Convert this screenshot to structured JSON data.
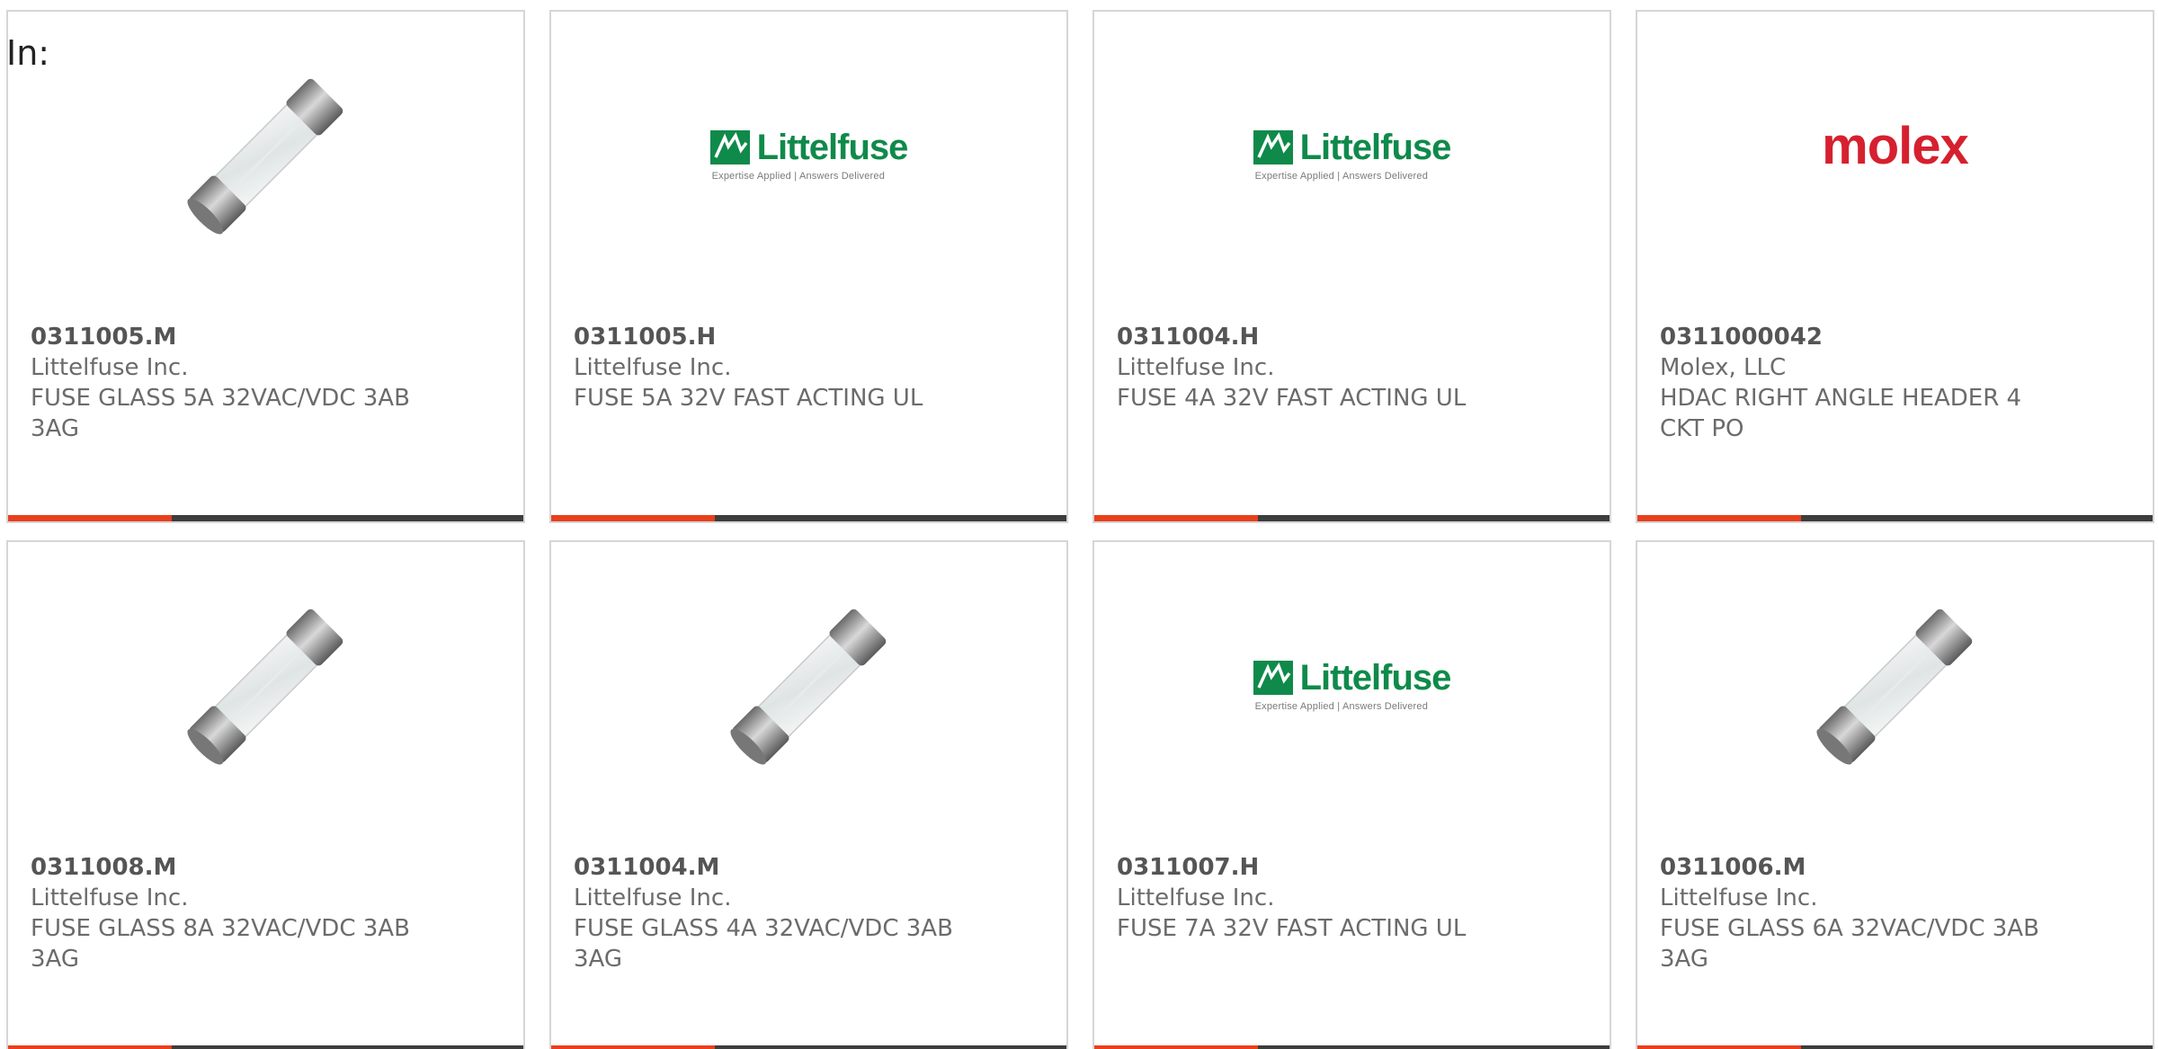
{
  "header": {
    "in_label": "In:"
  },
  "colors": {
    "accent_bar": "#e8401c",
    "bar_dark": "#3d3d3d",
    "littelfuse_green": "#0f8a4a",
    "molex_red": "#d6202f"
  },
  "products": [
    {
      "part": "0311005.M",
      "mfr": "Littelfuse Inc.",
      "desc1": "FUSE GLASS 5A 32VAC/VDC 3AB",
      "desc2": "3AG",
      "image": "glass-fuse-image"
    },
    {
      "part": "0311005.H",
      "mfr": "Littelfuse Inc.",
      "desc1": "FUSE 5A 32V FAST ACTING UL",
      "desc2": "",
      "image": "littelfuse-logo",
      "logo_word": "Littelfuse",
      "logo_tag": "Expertise Applied | Answers Delivered"
    },
    {
      "part": "0311004.H",
      "mfr": "Littelfuse Inc.",
      "desc1": "FUSE 4A 32V FAST ACTING UL",
      "desc2": "",
      "image": "littelfuse-logo",
      "logo_word": "Littelfuse",
      "logo_tag": "Expertise Applied | Answers Delivered"
    },
    {
      "part": "0311000042",
      "mfr": "Molex, LLC",
      "desc1": "HDAC RIGHT ANGLE HEADER 4",
      "desc2": "CKT PO",
      "image": "molex-logo",
      "logo_word": "molex"
    },
    {
      "part": "0311008.M",
      "mfr": "Littelfuse Inc.",
      "desc1": "FUSE GLASS 8A 32VAC/VDC 3AB",
      "desc2": "3AG",
      "image": "glass-fuse-image"
    },
    {
      "part": "0311004.M",
      "mfr": "Littelfuse Inc.",
      "desc1": "FUSE GLASS 4A 32VAC/VDC 3AB",
      "desc2": "3AG",
      "image": "glass-fuse-image"
    },
    {
      "part": "0311007.H",
      "mfr": "Littelfuse Inc.",
      "desc1": "FUSE 7A 32V FAST ACTING UL",
      "desc2": "",
      "image": "littelfuse-logo",
      "logo_word": "Littelfuse",
      "logo_tag": "Expertise Applied | Answers Delivered"
    },
    {
      "part": "0311006.M",
      "mfr": "Littelfuse Inc.",
      "desc1": "FUSE GLASS 6A 32VAC/VDC 3AB",
      "desc2": "3AG",
      "image": "glass-fuse-image"
    }
  ]
}
